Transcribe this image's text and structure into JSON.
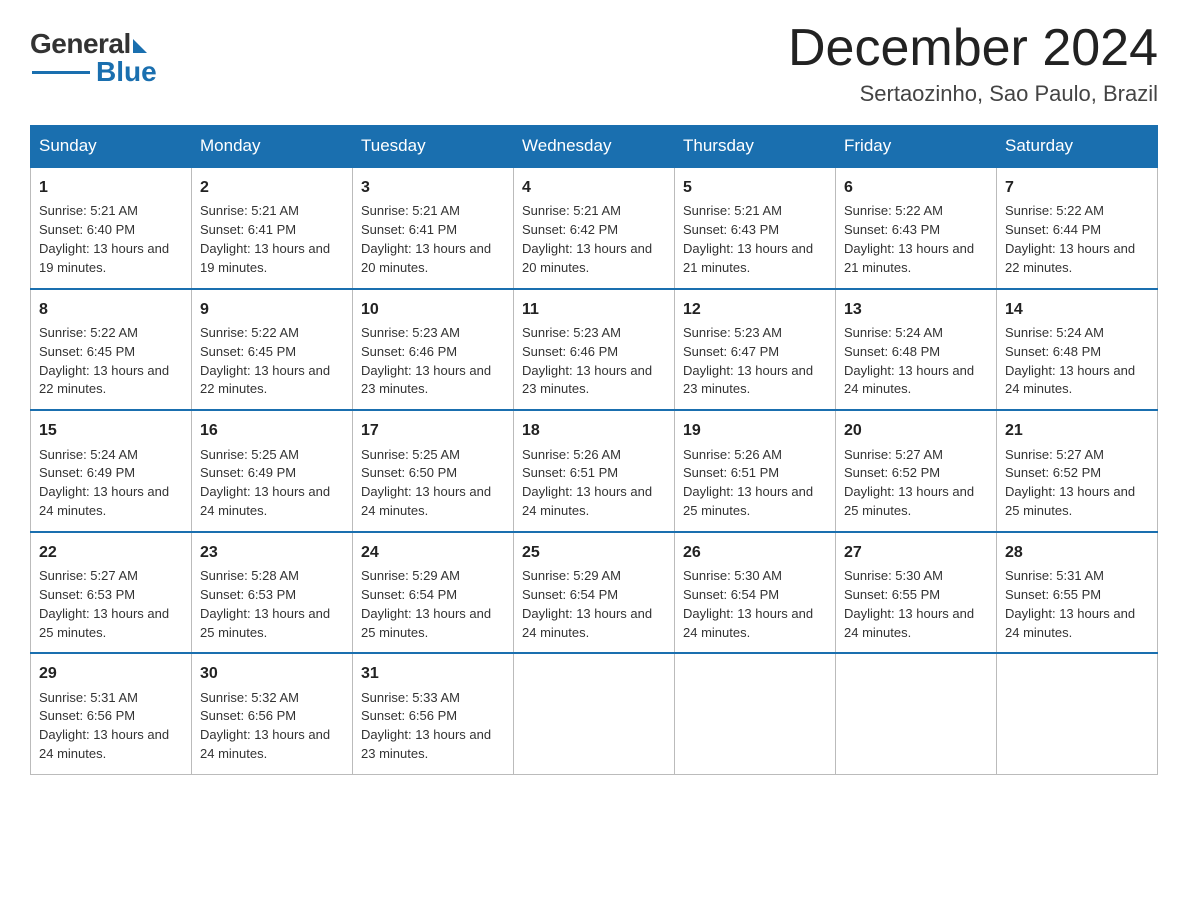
{
  "logo": {
    "general": "General",
    "blue": "Blue"
  },
  "title": "December 2024",
  "location": "Sertaozinho, Sao Paulo, Brazil",
  "weekdays": [
    "Sunday",
    "Monday",
    "Tuesday",
    "Wednesday",
    "Thursday",
    "Friday",
    "Saturday"
  ],
  "weeks": [
    [
      {
        "day": "1",
        "sunrise": "5:21 AM",
        "sunset": "6:40 PM",
        "daylight": "13 hours and 19 minutes."
      },
      {
        "day": "2",
        "sunrise": "5:21 AM",
        "sunset": "6:41 PM",
        "daylight": "13 hours and 19 minutes."
      },
      {
        "day": "3",
        "sunrise": "5:21 AM",
        "sunset": "6:41 PM",
        "daylight": "13 hours and 20 minutes."
      },
      {
        "day": "4",
        "sunrise": "5:21 AM",
        "sunset": "6:42 PM",
        "daylight": "13 hours and 20 minutes."
      },
      {
        "day": "5",
        "sunrise": "5:21 AM",
        "sunset": "6:43 PM",
        "daylight": "13 hours and 21 minutes."
      },
      {
        "day": "6",
        "sunrise": "5:22 AM",
        "sunset": "6:43 PM",
        "daylight": "13 hours and 21 minutes."
      },
      {
        "day": "7",
        "sunrise": "5:22 AM",
        "sunset": "6:44 PM",
        "daylight": "13 hours and 22 minutes."
      }
    ],
    [
      {
        "day": "8",
        "sunrise": "5:22 AM",
        "sunset": "6:45 PM",
        "daylight": "13 hours and 22 minutes."
      },
      {
        "day": "9",
        "sunrise": "5:22 AM",
        "sunset": "6:45 PM",
        "daylight": "13 hours and 22 minutes."
      },
      {
        "day": "10",
        "sunrise": "5:23 AM",
        "sunset": "6:46 PM",
        "daylight": "13 hours and 23 minutes."
      },
      {
        "day": "11",
        "sunrise": "5:23 AM",
        "sunset": "6:46 PM",
        "daylight": "13 hours and 23 minutes."
      },
      {
        "day": "12",
        "sunrise": "5:23 AM",
        "sunset": "6:47 PM",
        "daylight": "13 hours and 23 minutes."
      },
      {
        "day": "13",
        "sunrise": "5:24 AM",
        "sunset": "6:48 PM",
        "daylight": "13 hours and 24 minutes."
      },
      {
        "day": "14",
        "sunrise": "5:24 AM",
        "sunset": "6:48 PM",
        "daylight": "13 hours and 24 minutes."
      }
    ],
    [
      {
        "day": "15",
        "sunrise": "5:24 AM",
        "sunset": "6:49 PM",
        "daylight": "13 hours and 24 minutes."
      },
      {
        "day": "16",
        "sunrise": "5:25 AM",
        "sunset": "6:49 PM",
        "daylight": "13 hours and 24 minutes."
      },
      {
        "day": "17",
        "sunrise": "5:25 AM",
        "sunset": "6:50 PM",
        "daylight": "13 hours and 24 minutes."
      },
      {
        "day": "18",
        "sunrise": "5:26 AM",
        "sunset": "6:51 PM",
        "daylight": "13 hours and 24 minutes."
      },
      {
        "day": "19",
        "sunrise": "5:26 AM",
        "sunset": "6:51 PM",
        "daylight": "13 hours and 25 minutes."
      },
      {
        "day": "20",
        "sunrise": "5:27 AM",
        "sunset": "6:52 PM",
        "daylight": "13 hours and 25 minutes."
      },
      {
        "day": "21",
        "sunrise": "5:27 AM",
        "sunset": "6:52 PM",
        "daylight": "13 hours and 25 minutes."
      }
    ],
    [
      {
        "day": "22",
        "sunrise": "5:27 AM",
        "sunset": "6:53 PM",
        "daylight": "13 hours and 25 minutes."
      },
      {
        "day": "23",
        "sunrise": "5:28 AM",
        "sunset": "6:53 PM",
        "daylight": "13 hours and 25 minutes."
      },
      {
        "day": "24",
        "sunrise": "5:29 AM",
        "sunset": "6:54 PM",
        "daylight": "13 hours and 25 minutes."
      },
      {
        "day": "25",
        "sunrise": "5:29 AM",
        "sunset": "6:54 PM",
        "daylight": "13 hours and 24 minutes."
      },
      {
        "day": "26",
        "sunrise": "5:30 AM",
        "sunset": "6:54 PM",
        "daylight": "13 hours and 24 minutes."
      },
      {
        "day": "27",
        "sunrise": "5:30 AM",
        "sunset": "6:55 PM",
        "daylight": "13 hours and 24 minutes."
      },
      {
        "day": "28",
        "sunrise": "5:31 AM",
        "sunset": "6:55 PM",
        "daylight": "13 hours and 24 minutes."
      }
    ],
    [
      {
        "day": "29",
        "sunrise": "5:31 AM",
        "sunset": "6:56 PM",
        "daylight": "13 hours and 24 minutes."
      },
      {
        "day": "30",
        "sunrise": "5:32 AM",
        "sunset": "6:56 PM",
        "daylight": "13 hours and 24 minutes."
      },
      {
        "day": "31",
        "sunrise": "5:33 AM",
        "sunset": "6:56 PM",
        "daylight": "13 hours and 23 minutes."
      },
      null,
      null,
      null,
      null
    ]
  ]
}
